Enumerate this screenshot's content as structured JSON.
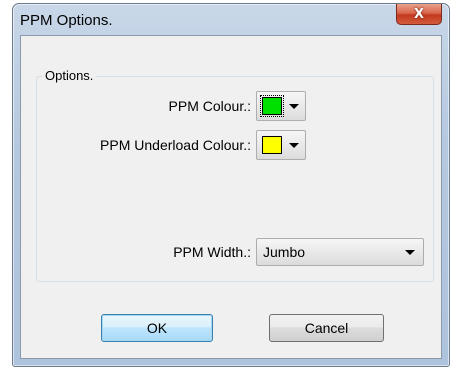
{
  "window": {
    "title": "PPM Options.",
    "close_glyph": "X"
  },
  "group": {
    "title": "Options."
  },
  "fields": {
    "ppm_colour_label": "PPM Colour.:",
    "ppm_colour_value": "#00e000",
    "ppm_underload_label": "PPM Underload Colour.:",
    "ppm_underload_value": "#ffff00",
    "ppm_width_label": "PPM Width.:",
    "ppm_width_value": "Jumbo"
  },
  "buttons": {
    "ok": "OK",
    "cancel": "Cancel"
  }
}
